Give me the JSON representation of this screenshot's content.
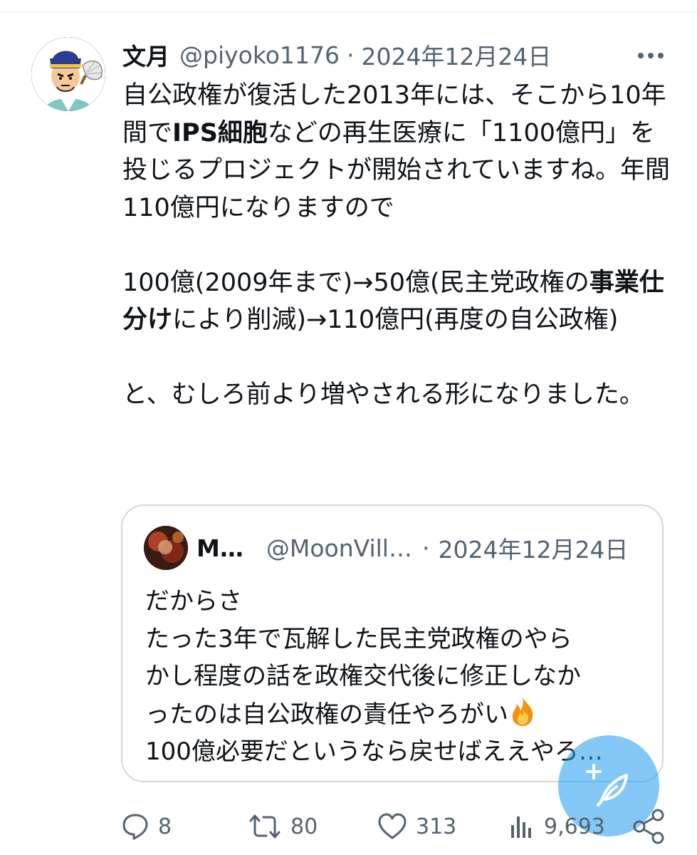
{
  "tweet": {
    "display_name": "文月",
    "handle": "@piyoko1176",
    "separator": "·",
    "date": "2024年12月24日",
    "paragraphs": [
      [
        {
          "t": "自公政権が復活した2013年には、そこから10年間で"
        },
        {
          "t": "IPS細胞",
          "b": true
        },
        {
          "t": "などの再生医療に「1100億円」を投じるプロジェクトが開始されていますね。年間110億円になりますので"
        }
      ],
      [
        {
          "t": "100億(2009年まで)→50億(民主党政権の"
        },
        {
          "t": "事業仕分け",
          "b": true
        },
        {
          "t": "により削減)→110億円(再度の自公政権)"
        }
      ],
      [
        {
          "t": "と、むしろ前より増やされる形になりました。"
        }
      ]
    ]
  },
  "quote": {
    "display_name": "M…",
    "handle": "@MoonVill…",
    "separator": "·",
    "date": "2024年12月24日",
    "lines": [
      "だからさ",
      "たった3年で瓦解した民主党政権のやら",
      "かし程度の話を政権交代後に修正しなか",
      "ったのは自公政権の責任やろがい",
      "100億必要だというなら戻せばええやろ…"
    ],
    "fire_icon": "fire-emoji"
  },
  "actions": {
    "replies": "8",
    "retweets": "80",
    "likes": "313",
    "views": "9,693"
  },
  "icons": {
    "more": "more-horizontal-icon",
    "reply": "reply-icon",
    "retweet": "retweet-icon",
    "like": "heart-icon",
    "views": "analytics-icon",
    "share": "share-icon",
    "compose": "compose-feather-icon"
  },
  "colors": {
    "text": "#0f1419",
    "secondary": "#536471",
    "border": "#cfd9de",
    "accent": "#1d9bf0"
  }
}
